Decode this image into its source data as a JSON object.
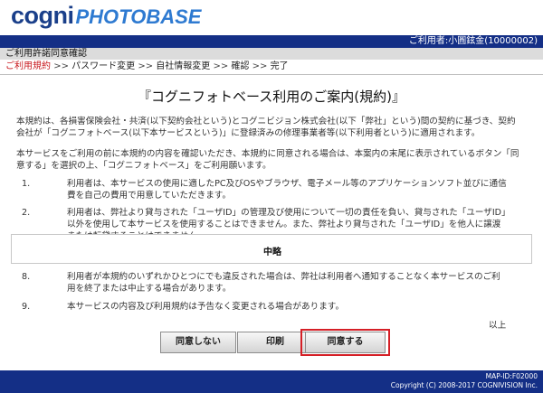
{
  "logo": {
    "main": "cogni",
    "sub": "PHOTOBASE"
  },
  "header": {
    "user": "ご利用者:小圓鉉金(10000002)"
  },
  "section_title": "ご利用許諾同意確認",
  "steps": {
    "current": "ご利用規約",
    "separator": ">>",
    "items": [
      "パスワード変更",
      "自社情報変更",
      "確認",
      "完了"
    ]
  },
  "title": "『コグニフォトベース利用のご案内(規約)』",
  "intro": [
    "本規約は、各損害保険会社・共済(以下契約会社という)とコグニビジョン株式会社(以下「弊社」という)間の契約に基づき、契約会社が「コグニフォトベース(以下本サービスという)」に登録済みの修理事業者等(以下利用者という)に適用されます。",
    "本サービスをご利用の前に本規約の内容を確認いただき、本規約に同意される場合は、本案内の末尾に表示されているボタン「同意する」を選択の上、「コグニフォトベース」をご利用願います。"
  ],
  "items_top": [
    {
      "num": "1.",
      "text": "利用者は、本サービスの使用に適したPC及びOSやブラウザ、電子メール等のアプリケーションソフト並びに通信費を自己の費用で用意していただきます。"
    },
    {
      "num": "2.",
      "text": "利用者は、弊社より貸与された「ユーザID」の管理及び使用について一切の責任を負い、貸与された「ユーザID」以外を使用して本サービスを使用することはできません。また、弊社より貸与された「ユーザID」を他人に譲渡または転貸することはできません。"
    }
  ],
  "omitted_label": "中略",
  "items_bottom": [
    {
      "num": "8.",
      "text": "利用者が本規約のいずれかひとつにでも違反された場合は、弊社は利用者へ通知することなく本サービスのご利用を終了または中止する場合があります。"
    },
    {
      "num": "9.",
      "text": "本サービスの内容及び利用規約は予告なく変更される場合があります。"
    }
  ],
  "end_text": "以上",
  "buttons": {
    "disagree": "同意しない",
    "print": "印刷",
    "agree": "同意する"
  },
  "colors": {
    "bar": "#142f86",
    "highlight": "#d51f26",
    "current_step": "#c8191e"
  },
  "footer": {
    "map_id": "MAP-ID:F02000",
    "copyright": "Copyright (C) 2008-2017 COGNIVISION Inc."
  }
}
